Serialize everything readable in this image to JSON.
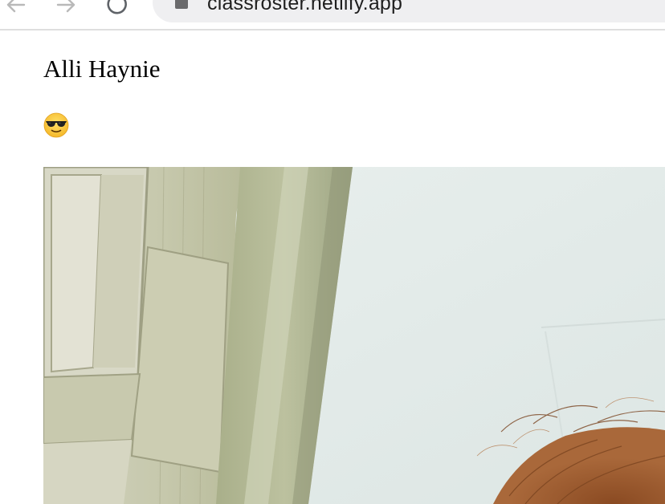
{
  "browser": {
    "url": "classroster.netlify.app",
    "icons": {
      "back": "back-arrow-icon",
      "forward": "forward-arrow-icon",
      "reload": "reload-icon",
      "site": "site-info-icon"
    }
  },
  "student": {
    "name": "Alli Haynie",
    "emoji_icon": "smiling-face-with-sunglasses-icon",
    "photo_subject": "student-photo"
  },
  "colors": {
    "page_background": "#ffffff",
    "address_bar": "#efeff1",
    "wall": "#e4ebe9",
    "trim": "#b4b896",
    "hair": "#9a5a2e"
  }
}
